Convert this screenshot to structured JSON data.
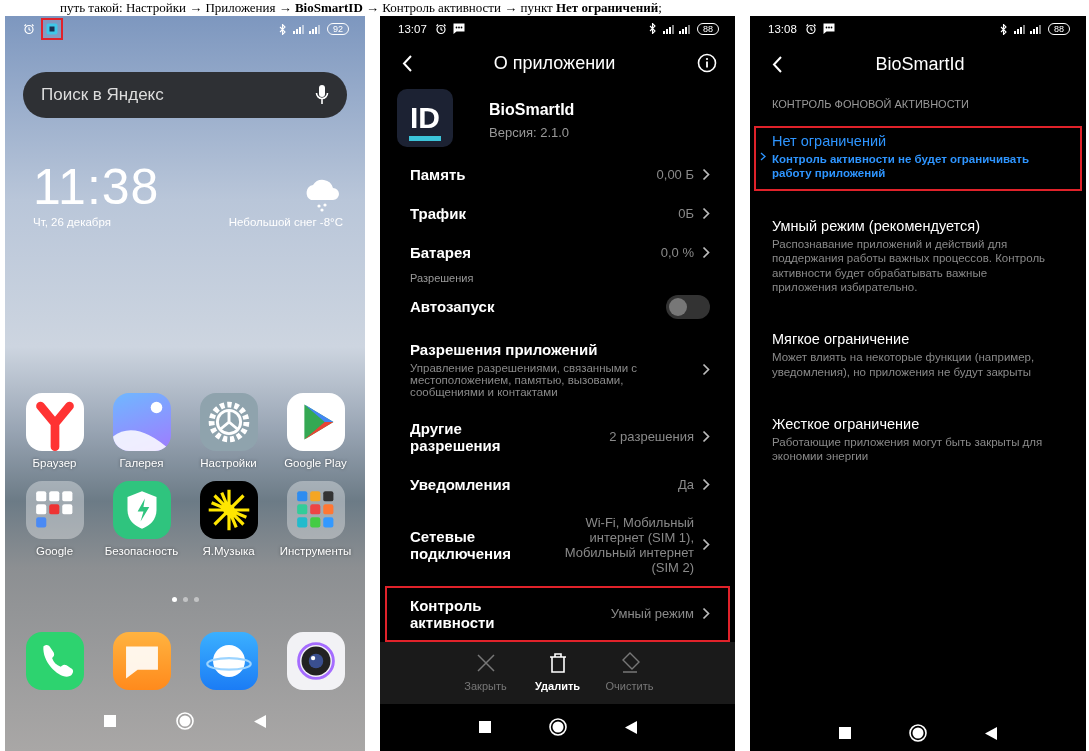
{
  "caption": {
    "text": "путь такой: Настройки → Приложения → **BioSmartID** → Контроль активности → пункт **Нет ограничений**;"
  },
  "home_screen": {
    "status_bar": {
      "icons": [
        {
          "kind": "alarm",
          "highlighted": false
        },
        {
          "kind": "app",
          "highlighted": true
        }
      ],
      "battery": "92"
    },
    "search": {
      "placeholder": "Поиск в Яндекс"
    },
    "clock": {
      "time": "11:38",
      "date": "Чт, 26 декабря"
    },
    "weather": {
      "condition": "Небольшой снег",
      "temperature": "-8°C"
    },
    "apps": [
      {
        "label": "Браузер",
        "kind": "yandex"
      },
      {
        "label": "Галерея",
        "kind": "gallery"
      },
      {
        "label": "Настройки",
        "kind": "settings"
      },
      {
        "label": "Google Play",
        "kind": "play"
      },
      {
        "label": "Google",
        "kind": "folder-google"
      },
      {
        "label": "Безопасность",
        "kind": "security"
      },
      {
        "label": "Я.Музыка",
        "kind": "music"
      },
      {
        "label": "Инструменты",
        "kind": "folder-tools"
      }
    ],
    "page_dots": [
      {
        "selected": true
      },
      {
        "selected": false
      },
      {
        "selected": false
      }
    ],
    "dock": [
      {
        "kind": "phone"
      },
      {
        "kind": "messages"
      },
      {
        "kind": "browser"
      },
      {
        "kind": "camera"
      }
    ]
  },
  "app_info": {
    "status_bar": {
      "time": "13:07",
      "icons": [
        {
          "kind": "alarm",
          "highlighted": false
        },
        {
          "kind": "message",
          "highlighted": false
        }
      ],
      "battery": "88"
    },
    "title": "О приложении",
    "app": {
      "name": "BioSmartId",
      "version": "Версия: 2.1.0",
      "icon_text": "ID"
    },
    "rows": [
      {
        "kind": "value",
        "label": "Память",
        "value": "0,00 Б",
        "highlighted": false
      },
      {
        "kind": "value",
        "label": "Трафик",
        "value": "0Б",
        "highlighted": false
      },
      {
        "kind": "value",
        "label": "Батарея",
        "value": "0,0 %",
        "highlighted": false
      },
      {
        "kind": "section",
        "label": "Разрешения"
      },
      {
        "kind": "toggle",
        "label": "Автозапуск",
        "on": false
      },
      {
        "kind": "detail",
        "label": "Разрешения приложений",
        "description": "Управление разрешениями, связанными с местоположением, памятью, вызовами, сообщениями и контактами"
      },
      {
        "kind": "value",
        "label": "Другие разрешения",
        "value": "2 разрешения",
        "highlighted": false
      },
      {
        "kind": "value",
        "label": "Уведомления",
        "value": "Да",
        "highlighted": false
      },
      {
        "kind": "value",
        "label": "Сетевые подключения",
        "value": "Wi-Fi, Мобильный интернет (SIM 1), Мобильный интернет (SIM 2)",
        "highlighted": false
      },
      {
        "kind": "value",
        "label": "Контроль активности",
        "value": "Умный режим",
        "highlighted": true
      }
    ],
    "actions": [
      {
        "kind": "close",
        "label": "Закрыть",
        "disabled": true
      },
      {
        "kind": "delete",
        "label": "Удалить",
        "disabled": false
      },
      {
        "kind": "clear",
        "label": "Очистить",
        "disabled": true
      }
    ]
  },
  "activity_control": {
    "status_bar": {
      "time": "13:08",
      "icons": [
        {
          "kind": "alarm",
          "highlighted": false
        },
        {
          "kind": "message",
          "highlighted": false
        }
      ],
      "battery": "88"
    },
    "title": "BioSmartId",
    "section": "КОНТРОЛЬ ФОНОВОЙ АКТИВНОСТИ",
    "options": [
      {
        "title": "Нет ограничений",
        "description": "Контроль активности не будет ограничивать работу приложений",
        "selected": true,
        "highlighted": true
      },
      {
        "title": "Умный режим (рекомендуется)",
        "description": "Распознавание приложений и действий для поддержания работы важных процессов. Контроль активности будет обрабатывать важные приложения избирательно.",
        "selected": false,
        "highlighted": false
      },
      {
        "title": "Мягкое ограничение",
        "description": "Может влиять на некоторые функции (например, уведомления), но приложения не будут закрыты",
        "selected": false,
        "highlighted": false
      },
      {
        "title": "Жесткое ограничение",
        "description": "Работающие приложения могут быть закрыты для экономии энергии",
        "selected": false,
        "highlighted": false
      }
    ]
  }
}
